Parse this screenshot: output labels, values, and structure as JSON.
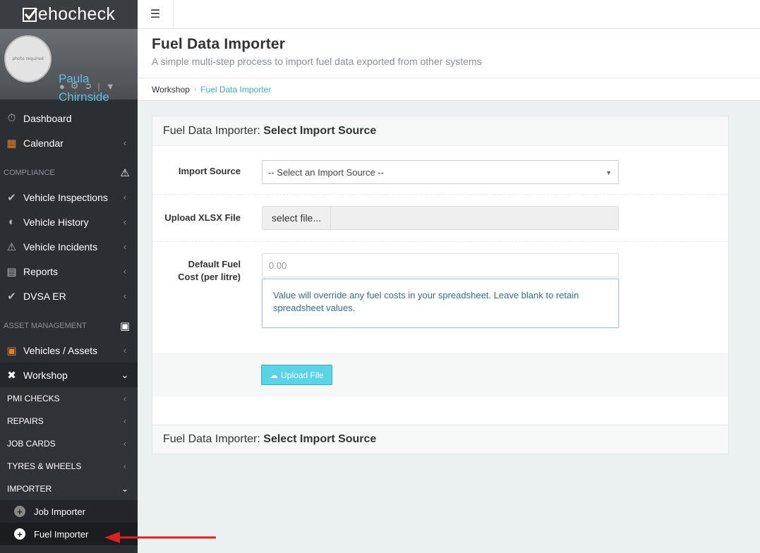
{
  "brand": {
    "logo_prefix": "V",
    "logo_rest": "ehocheck"
  },
  "user": {
    "avatar_text": "photo required",
    "name": "Paula Chirnside"
  },
  "nav": {
    "dashboard": "Dashboard",
    "calendar": "Calendar",
    "compliance_header": "COMPLIANCE",
    "vehicle_inspections": "Vehicle Inspections",
    "vehicle_history": "Vehicle History",
    "vehicle_incidents": "Vehicle Incidents",
    "reports": "Reports",
    "dvsa_er": "DVSA ER",
    "asset_header": "ASSET MANAGEMENT",
    "vehicles_assets": "Vehicles / Assets",
    "workshop": "Workshop",
    "pmi_checks": "PMI CHECKS",
    "repairs": "REPAIRS",
    "job_cards": "JOB CARDS",
    "tyres_wheels": "TYRES & WHEELS",
    "importer": "IMPORTER",
    "job_importer": "Job Importer",
    "fuel_importer": "Fuel Importer"
  },
  "page": {
    "title": "Fuel Data Importer",
    "subtitle": "A simple multi-step process to import fuel data exported from other systems"
  },
  "breadcrumb": {
    "item1": "Workshop",
    "item2": "Fuel Data Importer"
  },
  "panel": {
    "head_prefix": "Fuel Data Importer: ",
    "head_bold": "Select Import Source",
    "foot_prefix": "Fuel Data Importer: ",
    "foot_bold": "Select Import Source"
  },
  "form": {
    "import_source_label": "Import Source",
    "import_source_value": "-- Select an Import Source --",
    "upload_label": "Upload XLSX File",
    "select_file_label": "select file...",
    "fuel_cost_label_1": "Default Fuel",
    "fuel_cost_label_2": "Cost (per litre)",
    "fuel_cost_placeholder": "0.00",
    "help_text": "Value will override any fuel costs in your spreadsheet. Leave blank to retain spreadsheet values.",
    "upload_button": "Upload File"
  },
  "colors": {
    "accent": "#3ab0c3",
    "upload_button": "#5bd3e6",
    "orange": "#e67e22"
  }
}
